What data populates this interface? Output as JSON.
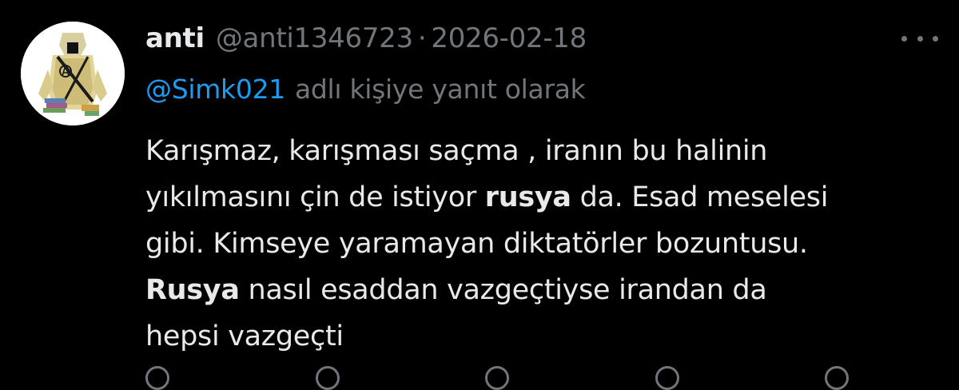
{
  "author": {
    "display_name": "anti",
    "handle": "@anti1346723",
    "separator": "·",
    "date": "2026-02-18"
  },
  "reply": {
    "mention": "@Simk021",
    "suffix": "adlı kişiye yanıt olarak"
  },
  "body": {
    "line1": "Karışmaz, karışması saçma , iranın bu halinin",
    "line2_pre": "yıkılmasını çin de istiyor ",
    "line2_bold": "rusya",
    "line2_post": " da. Esad meselesi",
    "line3": "gibi. Kimseye yaramayan diktatörler bozuntusu.",
    "line4_bold": "Rusya",
    "line4_post": " nasıl esaddan vazgeçtiyse irandan da",
    "line5": "hepsi vazgeçti"
  },
  "icons": {
    "avatar": "avatar-image",
    "more": "more-icon",
    "reply": "reply-icon",
    "retweet": "retweet-icon",
    "like": "like-icon",
    "views": "views-icon",
    "bookmark": "bookmark-icon"
  },
  "colors": {
    "background": "#000000",
    "text": "#e7e9ea",
    "muted": "#71767b",
    "link": "#1d9bf0"
  }
}
